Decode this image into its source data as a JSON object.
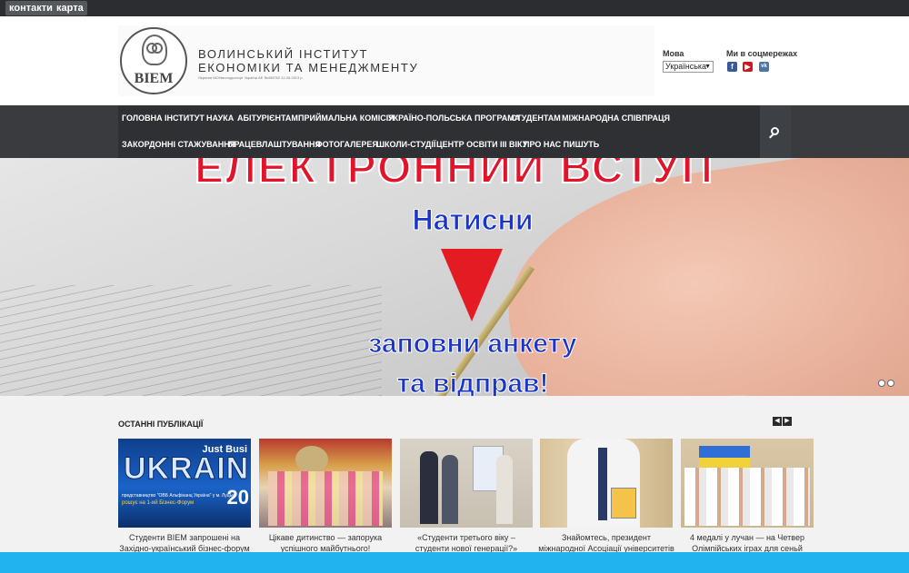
{
  "topbar": {
    "links": [
      "контакти",
      "карта"
    ]
  },
  "header": {
    "emblem_text": "BIEM",
    "name_line1": "ВОЛИНСЬКИЙ ІНСТИТУТ",
    "name_line2": "ЕКОНОМІКИ ТА МЕНЕДЖМЕНТУ",
    "license": "Ліцензія МОНмолодьспорт України АЕ №498762 22.05.2013 р.",
    "lang_label": "Мова",
    "lang_value": "Українська",
    "social_label": "Ми в соцмережах",
    "social": [
      {
        "icon": "facebook-icon",
        "glyph": "f",
        "color": "#3b5998"
      },
      {
        "icon": "youtube-icon",
        "glyph": "▶",
        "color": "#cc181e"
      },
      {
        "icon": "vk-icon",
        "glyph": "vk",
        "color": "#4c75a3"
      }
    ]
  },
  "nav": {
    "row1": [
      "ГОЛОВНА",
      "ІНСТИТУТ",
      "НАУКА",
      "АБІТУРІЄНТАМ",
      "ПРИЙМАЛЬНА КОМІСІЯ",
      "УКРАЇНО-ПОЛЬСЬКА ПРОГРАМА",
      "СТУДЕНТАМ",
      "МІЖНАРОДНА СПІВПРАЦЯ"
    ],
    "row2": [
      "ЗАКОРДОННІ СТАЖУВАННЯ",
      "ПРАЦЕВЛАШТУВАННЯ",
      "ФОТОГАЛЕРЕЯ",
      "ШКОЛИ-СТУДІЇ",
      "ЦЕНТР ОСВІТИ ІІІ ВІКУ",
      "ПРО НАС ПИШУТЬ"
    ]
  },
  "banner": {
    "title": "ЕЛЕКТРОННИЙ ВСТУП",
    "click": "Натисни",
    "fill": "заповни анкету",
    "send": "та відправ!"
  },
  "news": {
    "title": "ОСТАННІ ПУБЛІКАЦІЇ",
    "prev": "◀",
    "next": "▶",
    "items": [
      {
        "line1": "Студенти ВІЕМ запрошені на",
        "line2": "Західно-український бізнес-форум",
        "thumb_big": "UKRAIN",
        "thumb_small": "Just Busi",
        "thumb_year": "20",
        "thumb_sub1": "представництво \"ОВБ Альфінанц Україна\" у м. Луцьк",
        "thumb_sub2": "рошує на 1-ий  Бізнес-Форум"
      },
      {
        "line1": "Цікаве дитинство — запорука",
        "line2": "успішного майбутнього!"
      },
      {
        "line1": "«Студенти третього віку –",
        "line2": "студенти нової генерації?»"
      },
      {
        "line1": "Знайомтесь, президент",
        "line2": "міжнародної Асоціації університетів"
      },
      {
        "line1": "4 медалі у лучан — на Четвер",
        "line2": "Олімпійських іграх для сеньй"
      }
    ]
  }
}
